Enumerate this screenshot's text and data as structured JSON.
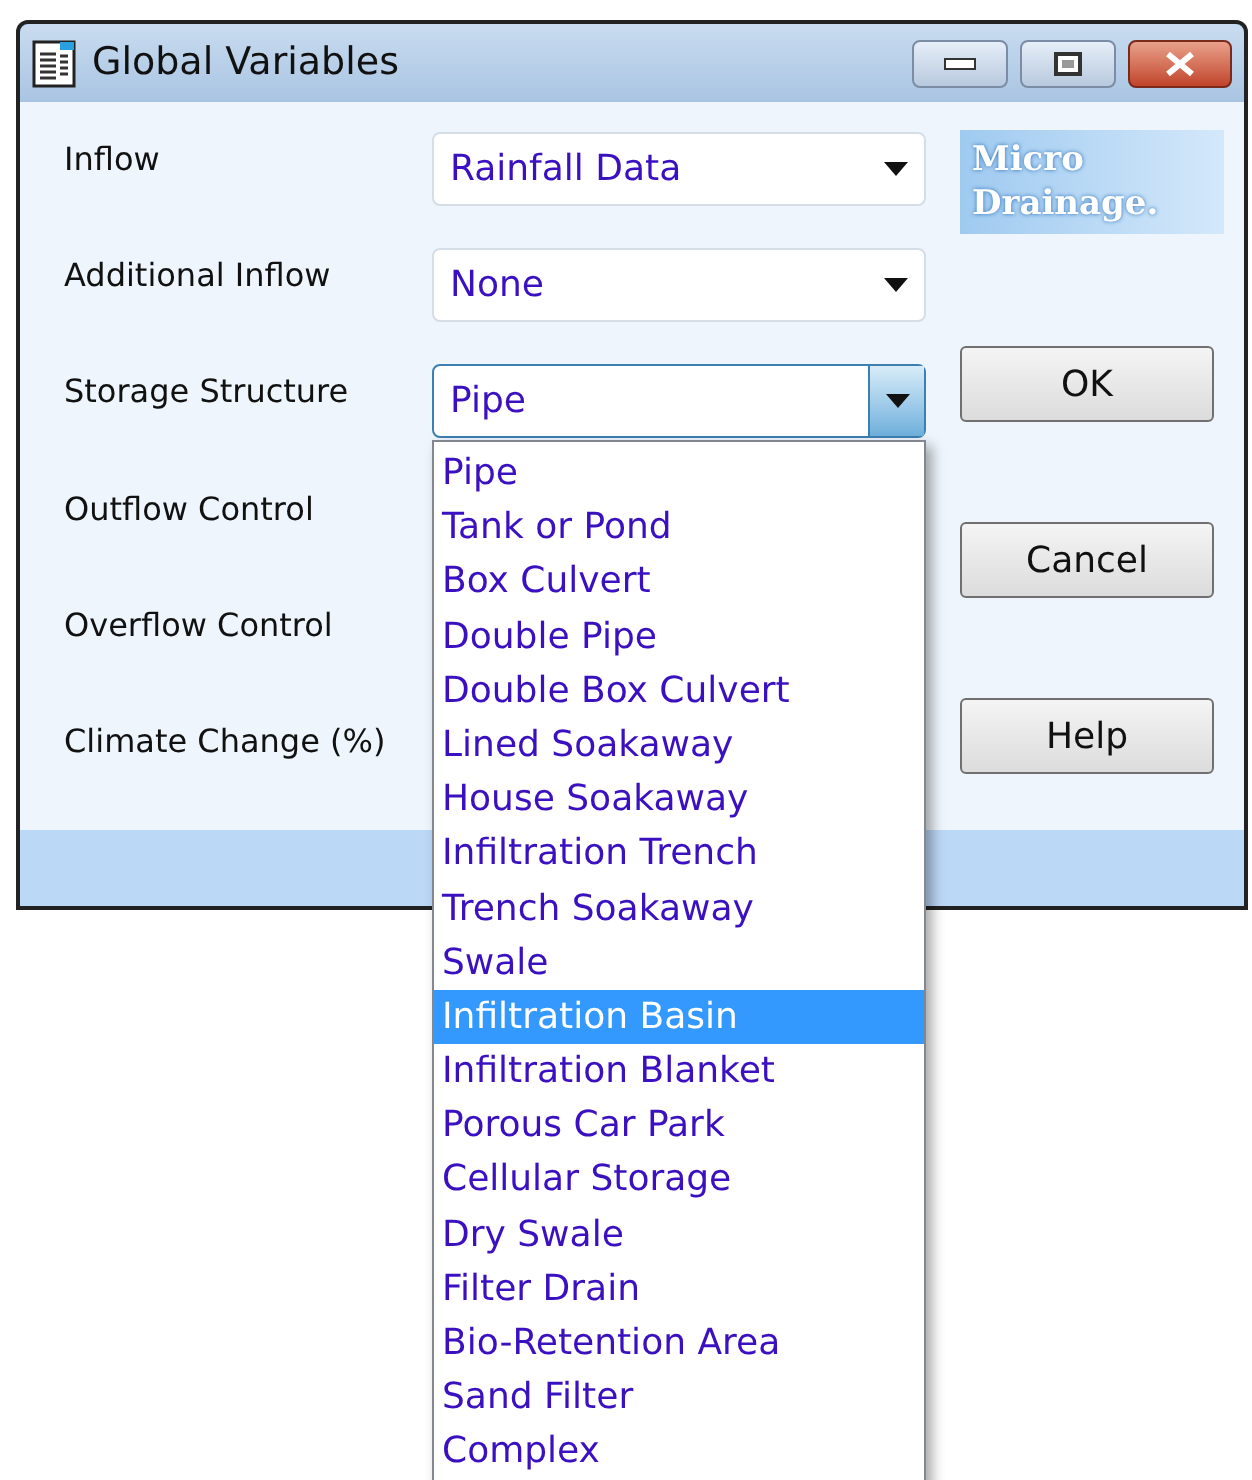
{
  "window": {
    "title": "Global Variables"
  },
  "logo": {
    "lines": [
      "Micro",
      "Drainage."
    ]
  },
  "rows": [
    {
      "label": "Inflow",
      "dropdown": {
        "value": "Rainfall Data",
        "focused": false
      }
    },
    {
      "label": "Additional Inflow",
      "dropdown": {
        "value": "None",
        "focused": false
      }
    },
    {
      "label": "Storage Structure",
      "dropdown": {
        "value": "Pipe",
        "focused": true
      }
    },
    {
      "label": "Outflow Control"
    },
    {
      "label": "Overflow Control"
    },
    {
      "label": "Climate Change (%)"
    }
  ],
  "dropdown_list": {
    "items": [
      {
        "label": "Pipe",
        "selected": false
      },
      {
        "label": "Tank or Pond",
        "selected": false
      },
      {
        "label": "Box Culvert",
        "selected": false
      },
      {
        "label": "Double Pipe",
        "selected": false
      },
      {
        "label": "Double Box Culvert",
        "selected": false
      },
      {
        "label": "Lined Soakaway",
        "selected": false
      },
      {
        "label": "House Soakaway",
        "selected": false
      },
      {
        "label": "Infiltration Trench",
        "selected": false
      },
      {
        "label": "Trench Soakaway",
        "selected": false
      },
      {
        "label": "Swale",
        "selected": false
      },
      {
        "label": "Infiltration Basin",
        "selected": true
      },
      {
        "label": "Infiltration Blanket",
        "selected": false
      },
      {
        "label": "Porous Car Park",
        "selected": false
      },
      {
        "label": "Cellular Storage",
        "selected": false
      },
      {
        "label": "Dry Swale",
        "selected": false
      },
      {
        "label": "Filter Drain",
        "selected": false
      },
      {
        "label": "Bio-Retention Area",
        "selected": false
      },
      {
        "label": "Sand Filter",
        "selected": false
      },
      {
        "label": "Complex",
        "selected": false
      }
    ]
  },
  "buttons": [
    "OK",
    "Cancel",
    "Help"
  ]
}
